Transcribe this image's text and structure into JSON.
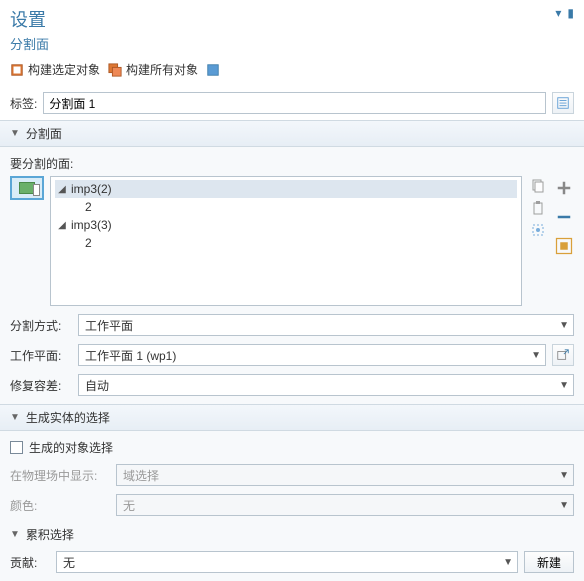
{
  "header": {
    "title": "设置",
    "subtitle": "分割面"
  },
  "toolbar": {
    "build_selected": "构建选定对象",
    "build_all": "构建所有对象"
  },
  "label_field": {
    "label": "标签:",
    "value": "分割面 1"
  },
  "section1": {
    "title": "分割面",
    "faces_label": "要分割的面:",
    "tree": [
      {
        "label": "imp3(2)",
        "children": [
          "2"
        ],
        "selected": true
      },
      {
        "label": "imp3(3)",
        "children": [
          "2"
        ],
        "selected": false
      }
    ],
    "method_label": "分割方式:",
    "method_value": "工作平面",
    "plane_label": "工作平面:",
    "plane_value": "工作平面 1 (wp1)",
    "repair_label": "修复容差:",
    "repair_value": "自动"
  },
  "section2": {
    "title": "生成实体的选择",
    "check_label": "生成的对象选择",
    "show_in_label": "在物理场中显示:",
    "show_in_value": "域选择",
    "color_label": "颜色:",
    "color_value": "无",
    "acc_title": "累积选择",
    "contrib_label": "贡献:",
    "contrib_value": "无",
    "new_btn": "新建"
  }
}
